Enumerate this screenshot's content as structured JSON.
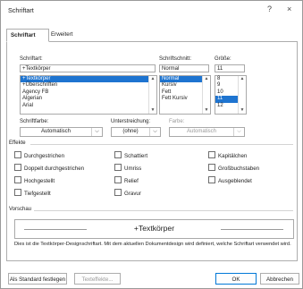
{
  "window": {
    "title": "Schriftart",
    "help": "?",
    "close": "×"
  },
  "tabs": [
    {
      "label": "Schriftart"
    },
    {
      "label": "Erweitert"
    }
  ],
  "font": {
    "label": "Schriftart:",
    "value": "+Textkörper",
    "items": [
      "+Textkörper",
      "+Überschriften",
      "Agency FB",
      "Algerian",
      "Arial"
    ],
    "selected_index": 0
  },
  "style": {
    "label": "Schriftschnitt:",
    "value": "Normal",
    "items": [
      "Normal",
      "Kursiv",
      "Fett",
      "Fett Kursiv"
    ],
    "selected_index": 0
  },
  "size": {
    "label": "Größe:",
    "value": "11",
    "items": [
      "8",
      "9",
      "10",
      "11",
      "12"
    ],
    "selected_index": 3
  },
  "font_color": {
    "label": "Schriftfarbe:",
    "value": "Automatisch"
  },
  "underline": {
    "label": "Unterstreichung:",
    "value": "(ohne)"
  },
  "underline_color": {
    "label": "Farbe:",
    "value": "Automatisch"
  },
  "effects": {
    "title": "Effekte",
    "col1": [
      "Durchgestrichen",
      "Doppelt durchgestrichen",
      "Hochgestellt",
      "Tiefgestellt"
    ],
    "col2": [
      "Schattiert",
      "Umriss",
      "Relief",
      "Gravur"
    ],
    "col3": [
      "Kapitälchen",
      "Großbuchstaben",
      "Ausgeblendet"
    ]
  },
  "preview": {
    "title": "Vorschau",
    "text": "+Textkörper",
    "description": "Dies ist die Textkörper-Designschriftart. Mit dem aktuellen Dokumentdesign wird definiert, welche Schriftart verwendet wird."
  },
  "buttons": {
    "default": "Als Standard festlegen",
    "effects": "Texteffekte...",
    "ok": "OK",
    "cancel": "Abbrechen"
  }
}
